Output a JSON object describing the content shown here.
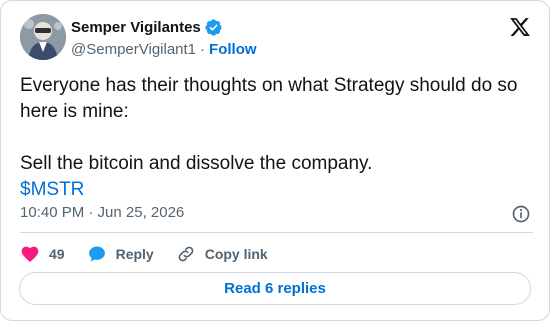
{
  "author": {
    "display_name": "Semper Vigilantes",
    "handle": "@SemperVigilant1",
    "separator": "·",
    "follow_label": "Follow",
    "verified": true
  },
  "tweet": {
    "line1": "Everyone has their thoughts on what Strategy should do so here is mine:",
    "line2": "Sell the bitcoin and dissolve the company.",
    "cashtag": "$MSTR",
    "timestamp": "10:40 PM · Jun 25, 2026"
  },
  "actions": {
    "like_count": "49",
    "reply_label": "Reply",
    "copy_link_label": "Copy link"
  },
  "replies_button": {
    "label": "Read 6 replies"
  },
  "colors": {
    "link": "#006fd6",
    "verified": "#1d9bf0",
    "like": "#f91880",
    "secondary_text": "#536471",
    "border": "#cfd9de"
  },
  "icons": [
    "verified-badge-icon",
    "x-logo-icon",
    "info-icon",
    "heart-icon",
    "reply-bubble-icon",
    "link-icon"
  ]
}
